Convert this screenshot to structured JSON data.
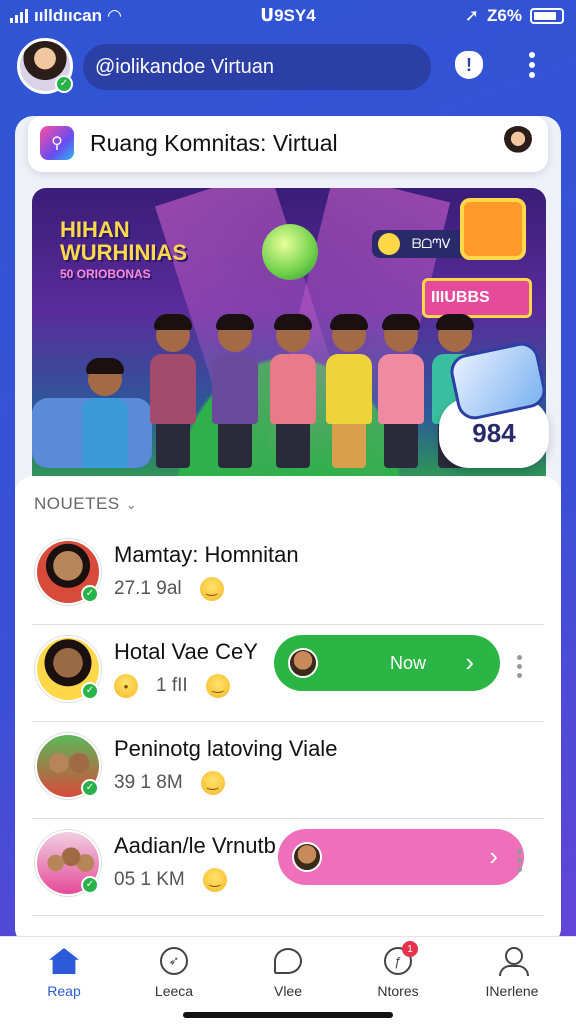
{
  "status_bar": {
    "carrier": "ıılldııcan",
    "time": "ᑌ9SY4",
    "battery": "Z6%"
  },
  "header": {
    "search_text": "@iolikandoe Virtuan",
    "alert_icon": "shield-alert-icon",
    "menu_icon": "kebab-menu-icon"
  },
  "title_bar": {
    "title": "Ruang Komnitas: Virtual",
    "app_icon": "community-app-icon"
  },
  "banner": {
    "heading": "HIHAN WURHINIAS",
    "subheading": "50 ORIOBONAS",
    "tag": "ᗷᗝᘉᐯ",
    "sign": "IIIUBBS",
    "time_badge": "984"
  },
  "list": {
    "sort_label": "NOUETES",
    "items": [
      {
        "name": "Mamtay: Homnitan",
        "meta": "27.1 9al",
        "action": null
      },
      {
        "name": "Hotal Vae CeY",
        "meta": "1 fII",
        "action": {
          "label": "Now",
          "color": "#2bb544"
        }
      },
      {
        "name": "Peninotg latoving Viale",
        "meta": "39 1 8M",
        "action": null
      },
      {
        "name": "Aadian/le Vrnutb",
        "meta": "05 1 KM",
        "action": {
          "label": "",
          "color": "#f06fbb"
        }
      }
    ]
  },
  "bottom_nav": [
    {
      "label": "Reap",
      "icon": "home-icon",
      "active": true,
      "badge": ""
    },
    {
      "label": "Leeca",
      "icon": "compass-icon",
      "active": false,
      "badge": ""
    },
    {
      "label": "Vlee",
      "icon": "chat-icon",
      "active": false,
      "badge": ""
    },
    {
      "label": "Ntores",
      "icon": "notifications-icon",
      "active": false,
      "badge": "1"
    },
    {
      "label": "INerlene",
      "icon": "profile-icon",
      "active": false,
      "badge": ""
    }
  ],
  "colors": {
    "primary": "#2c5ad8",
    "accent_green": "#2bb544",
    "accent_pink": "#f06fbb",
    "online": "#27b24a"
  }
}
